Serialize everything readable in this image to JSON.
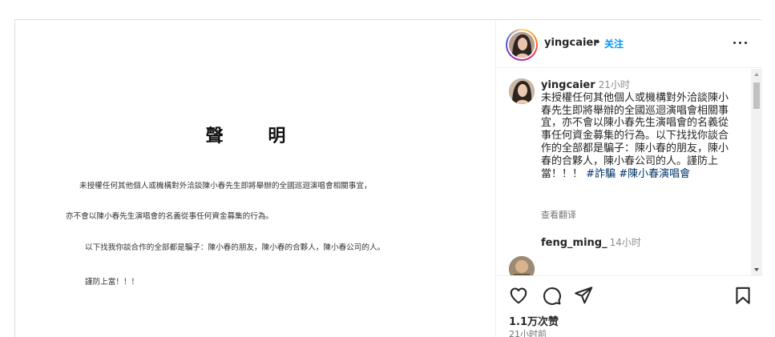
{
  "statement": {
    "title": "聲 明",
    "lines": [
      "未授權任何其他個人或機構對外洽談陳小春先生即將舉辦的全國巡迴演唱會相關事宜，",
      "亦不會以陳小春先生演唱會的名義從事任何資金募集的行為。",
      "以下找我你談合作的全部都是騙子：陳小春的朋友，陳小春的合夥人，陳小春公司的人。",
      "謹防上當！！！"
    ]
  },
  "header": {
    "username": "yingcaier",
    "dot": "•",
    "follow_label": "关注",
    "more_icon": "more-horizontal-icon"
  },
  "caption": {
    "username": "yingcaier",
    "time": "21小时",
    "text": "未授權任何其他個人或機構對外洽談陳小春先生即將舉辦的全國巡迴演唱會相關事宜，亦不會以陳小春先生演唱會的名義從事任何資金募集的行為。以下找找你談合作的全部都是騙子：陳小春的朋友，陳小春的合夥人，陳小春公司的人。謹防上當！！！",
    "hashtags": [
      "#詐騙",
      "#陳小春演唱會"
    ],
    "translate_label": "查看翻译"
  },
  "comments": [
    {
      "username": "feng_ming_",
      "time": "14小时"
    }
  ],
  "actions": {
    "icons": [
      "heart-icon",
      "comment-icon",
      "share-icon",
      "bookmark-icon"
    ],
    "likes": "1.1万次赞",
    "posted": "21小时前"
  },
  "colors": {
    "follow": "#0095f6",
    "hashtag": "#00376b",
    "muted": "#737373",
    "border": "#dbdbdb"
  }
}
